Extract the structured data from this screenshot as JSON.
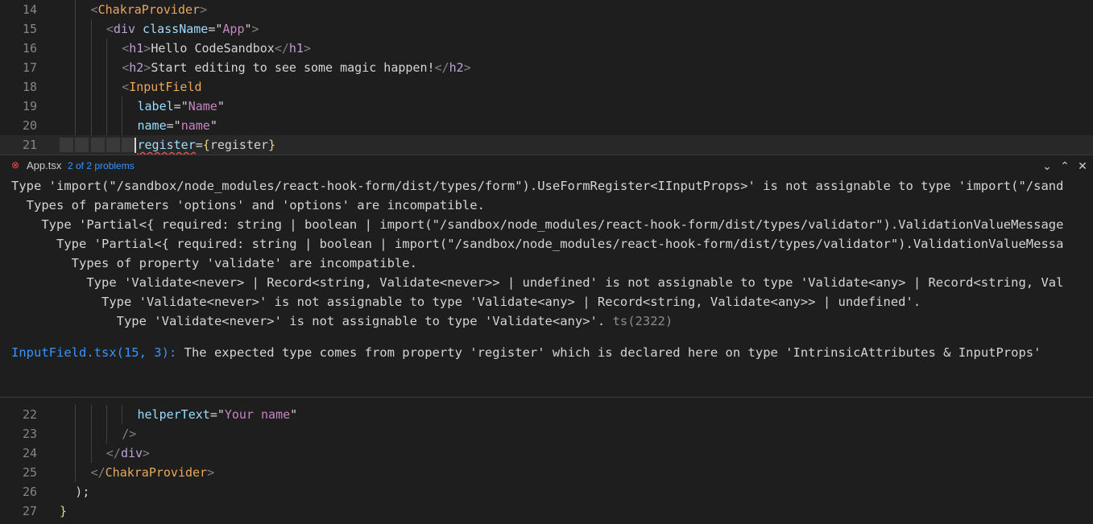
{
  "editor_top": {
    "lines": [
      {
        "num": "14",
        "parts": [
          [
            "tag",
            "<"
          ],
          [
            "cmp",
            "ChakraProvider"
          ],
          [
            "tag",
            ">"
          ]
        ]
      },
      {
        "num": "15",
        "parts": [
          [
            "tag",
            "<"
          ],
          [
            "html",
            "div"
          ],
          [
            "txt",
            " "
          ],
          [
            "attr",
            "className"
          ],
          [
            "txt",
            "="
          ],
          [
            "txt",
            "\""
          ],
          [
            "str",
            "App"
          ],
          [
            "txt",
            "\""
          ],
          [
            "tag",
            ">"
          ]
        ]
      },
      {
        "num": "16",
        "parts": [
          [
            "tag",
            "<"
          ],
          [
            "html",
            "h1"
          ],
          [
            "tag",
            ">"
          ],
          [
            "txt",
            "Hello CodeSandbox"
          ],
          [
            "tag",
            "</"
          ],
          [
            "html",
            "h1"
          ],
          [
            "tag",
            ">"
          ]
        ]
      },
      {
        "num": "17",
        "parts": [
          [
            "tag",
            "<"
          ],
          [
            "html",
            "h2"
          ],
          [
            "tag",
            ">"
          ],
          [
            "txt",
            "Start editing to see some magic happen!"
          ],
          [
            "tag",
            "</"
          ],
          [
            "html",
            "h2"
          ],
          [
            "tag",
            ">"
          ]
        ]
      },
      {
        "num": "18",
        "parts": [
          [
            "tag",
            "<"
          ],
          [
            "cmp",
            "InputField"
          ]
        ]
      },
      {
        "num": "19",
        "parts": [
          [
            "attr",
            "label"
          ],
          [
            "txt",
            "="
          ],
          [
            "txt",
            "\""
          ],
          [
            "str",
            "Name"
          ],
          [
            "txt",
            "\""
          ]
        ]
      },
      {
        "num": "20",
        "parts": [
          [
            "attr",
            "name"
          ],
          [
            "txt",
            "="
          ],
          [
            "txt",
            "\""
          ],
          [
            "str",
            "name"
          ],
          [
            "txt",
            "\""
          ]
        ]
      },
      {
        "num": "21",
        "parts": [
          [
            "attr",
            "register"
          ],
          [
            "txt",
            "="
          ],
          [
            "brace",
            "{"
          ],
          [
            "txt",
            "register"
          ],
          [
            "brace",
            "}"
          ]
        ]
      }
    ]
  },
  "problems_panel": {
    "file_name": "App.tsx",
    "problem_count": "2 of 2 problems",
    "icons": {
      "error": "error-circle-icon",
      "next": "chevron-down-icon",
      "prev": "chevron-up-icon",
      "close": "close-icon"
    },
    "message_lines": [
      "Type 'import(\"/sandbox/node_modules/react-hook-form/dist/types/form\").UseFormRegister<IInputProps>' is not assignable to type 'import(\"/sand",
      "  Types of parameters 'options' and 'options' are incompatible.",
      "    Type 'Partial<{ required: string | boolean | import(\"/sandbox/node_modules/react-hook-form/dist/types/validator\").ValidationValueMessage",
      "      Type 'Partial<{ required: string | boolean | import(\"/sandbox/node_modules/react-hook-form/dist/types/validator\").ValidationValueMessa",
      "        Types of property 'validate' are incompatible.",
      "          Type 'Validate<never> | Record<string, Validate<never>> | undefined' is not assignable to type 'Validate<any> | Record<string, Val",
      "            Type 'Validate<never>' is not assignable to type 'Validate<any> | Record<string, Validate<any>> | undefined'.",
      "              Type 'Validate<never>' is not assignable to type 'Validate<any>'."
    ],
    "ts_code": "ts(2322)",
    "related_link": "InputField.tsx(15, 3):",
    "related_text": " The expected type comes from property 'register' which is declared here on type 'IntrinsicAttributes & InputProps'"
  },
  "editor_bottom": {
    "lines": [
      {
        "num": "22",
        "parts": [
          [
            "attr",
            "helperText"
          ],
          [
            "txt",
            "="
          ],
          [
            "txt",
            "\""
          ],
          [
            "str",
            "Your name"
          ],
          [
            "txt",
            "\""
          ]
        ]
      },
      {
        "num": "23",
        "parts": [
          [
            "tag",
            "/>"
          ]
        ]
      },
      {
        "num": "24",
        "parts": [
          [
            "tag",
            "</"
          ],
          [
            "html",
            "div"
          ],
          [
            "tag",
            ">"
          ]
        ]
      },
      {
        "num": "25",
        "parts": [
          [
            "tag",
            "</"
          ],
          [
            "cmp",
            "ChakraProvider"
          ],
          [
            "tag",
            ">"
          ]
        ]
      },
      {
        "num": "26",
        "parts": [
          [
            "txt",
            ");"
          ]
        ]
      },
      {
        "num": "27",
        "parts": [
          [
            "brace",
            "}"
          ]
        ]
      }
    ]
  }
}
